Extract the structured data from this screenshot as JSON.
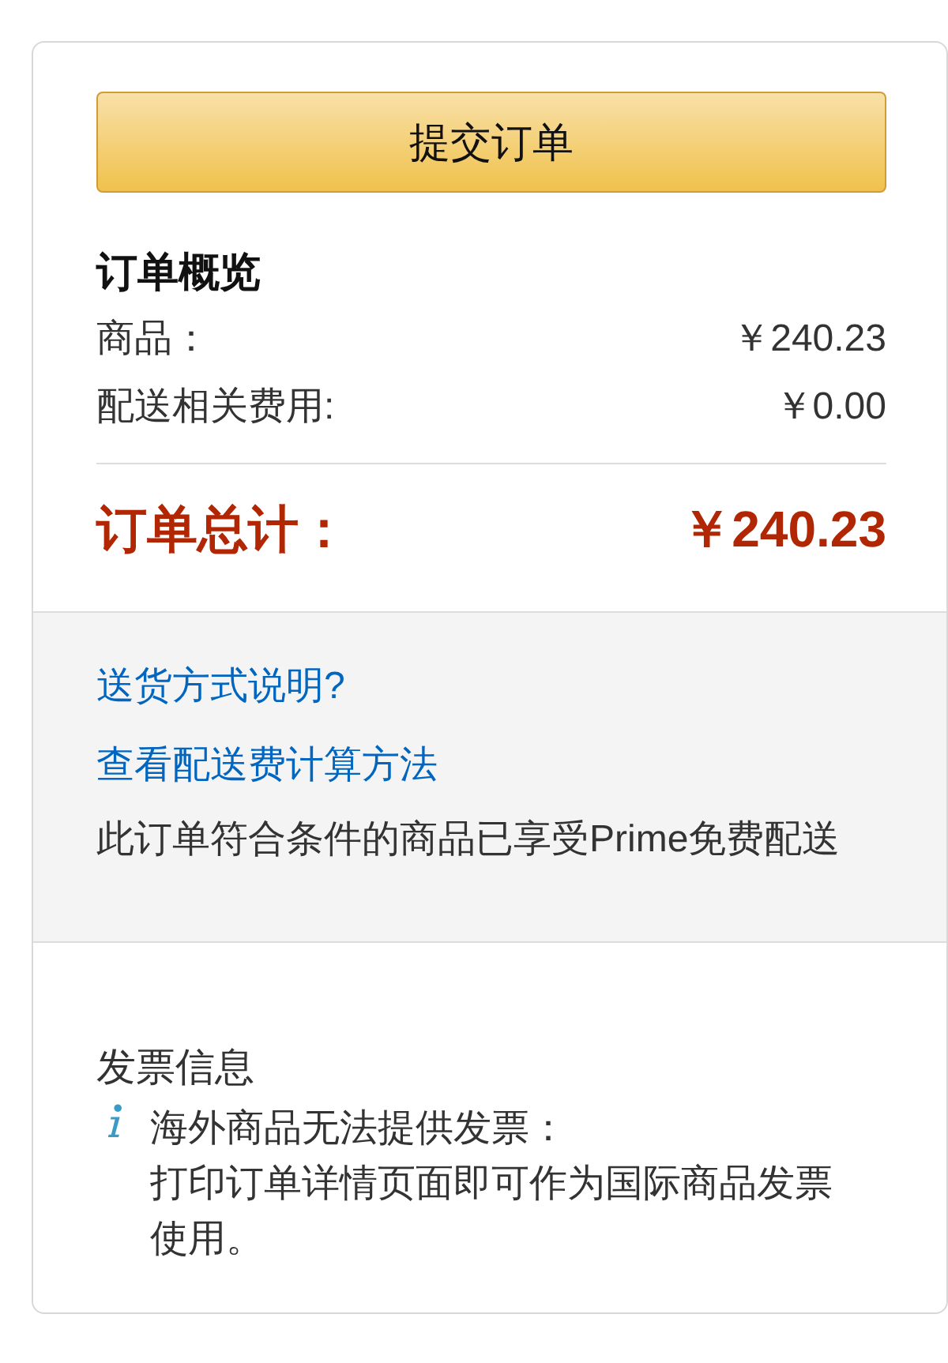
{
  "place_order_button": {
    "label": "提交订单"
  },
  "summary": {
    "title": "订单概览",
    "rows": [
      {
        "label": "商品：",
        "amount": "￥240.23"
      },
      {
        "label": "配送相关费用:",
        "amount": "￥0.00"
      }
    ],
    "total": {
      "label": "订单总计：",
      "amount": "￥240.23"
    }
  },
  "shipping_info": {
    "links": [
      "送货方式说明?",
      "查看配送费计算方法"
    ],
    "note": "此订单符合条件的商品已享受Prime免费配送"
  },
  "invoice": {
    "title": "发票信息",
    "notice": [
      "海外商品无法提供发票：",
      "打印订单详情页面即可作为国际商品发票使用。"
    ]
  }
}
